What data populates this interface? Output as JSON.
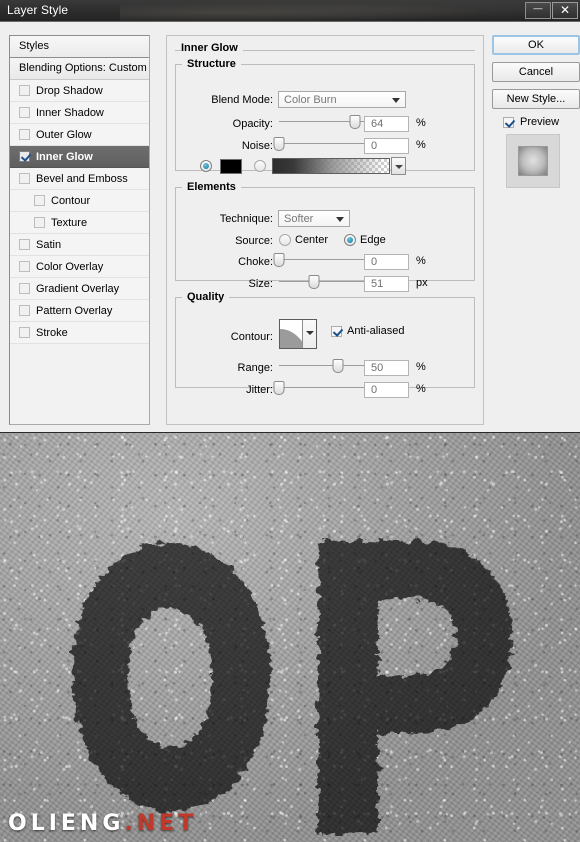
{
  "window": {
    "title": "Layer Style",
    "minimize_label": "—",
    "close_label": "✕"
  },
  "styles_panel": {
    "header": "Styles",
    "blending_options": "Blending Options: Custom",
    "items": [
      {
        "label": "Drop Shadow",
        "checked": false,
        "indent": false,
        "selected": false
      },
      {
        "label": "Inner Shadow",
        "checked": false,
        "indent": false,
        "selected": false
      },
      {
        "label": "Outer Glow",
        "checked": false,
        "indent": false,
        "selected": false
      },
      {
        "label": "Inner Glow",
        "checked": true,
        "indent": false,
        "selected": true
      },
      {
        "label": "Bevel and Emboss",
        "checked": false,
        "indent": false,
        "selected": false
      },
      {
        "label": "Contour",
        "checked": false,
        "indent": true,
        "selected": false
      },
      {
        "label": "Texture",
        "checked": false,
        "indent": true,
        "selected": false
      },
      {
        "label": "Satin",
        "checked": false,
        "indent": false,
        "selected": false
      },
      {
        "label": "Color Overlay",
        "checked": false,
        "indent": false,
        "selected": false
      },
      {
        "label": "Gradient Overlay",
        "checked": false,
        "indent": false,
        "selected": false
      },
      {
        "label": "Pattern Overlay",
        "checked": false,
        "indent": false,
        "selected": false
      },
      {
        "label": "Stroke",
        "checked": false,
        "indent": false,
        "selected": false
      }
    ]
  },
  "settings": {
    "panel_title": "Inner Glow",
    "structure": {
      "legend": "Structure",
      "blend_mode_label": "Blend Mode:",
      "blend_mode_value": "Color Burn",
      "opacity_label": "Opacity:",
      "opacity_value": "64",
      "opacity_unit": "%",
      "opacity_percent": 64,
      "noise_label": "Noise:",
      "noise_value": "0",
      "noise_unit": "%",
      "noise_percent": 0,
      "fill_mode": "color",
      "color_hex": "#000000"
    },
    "elements": {
      "legend": "Elements",
      "technique_label": "Technique:",
      "technique_value": "Softer",
      "source_label": "Source:",
      "source_center_label": "Center",
      "source_edge_label": "Edge",
      "source_selected": "Edge",
      "choke_label": "Choke:",
      "choke_value": "0",
      "choke_unit": "%",
      "choke_percent": 0,
      "size_label": "Size:",
      "size_value": "51",
      "size_unit": "px",
      "size_percent": 30
    },
    "quality": {
      "legend": "Quality",
      "contour_label": "Contour:",
      "anti_aliased_label": "Anti-aliased",
      "anti_aliased_checked": true,
      "range_label": "Range:",
      "range_value": "50",
      "range_unit": "%",
      "range_percent": 50,
      "jitter_label": "Jitter:",
      "jitter_value": "0",
      "jitter_unit": "%",
      "jitter_percent": 0
    }
  },
  "buttons": {
    "ok": "OK",
    "cancel": "Cancel",
    "new_style": "New Style...",
    "preview_label": "Preview",
    "preview_checked": true
  },
  "photo": {
    "description": "OP stencil letters painted on cracked gray concrete pavement",
    "watermark_main": "OLIENG",
    "watermark_suffix": ".NET"
  },
  "colors": {
    "accent": "#1277a0",
    "selected_row_bg": "#6e6e6e",
    "titlebar_bg": "#2e2e2e",
    "dialog_bg": "#efeff0",
    "watermark_red": "#c0392b"
  }
}
